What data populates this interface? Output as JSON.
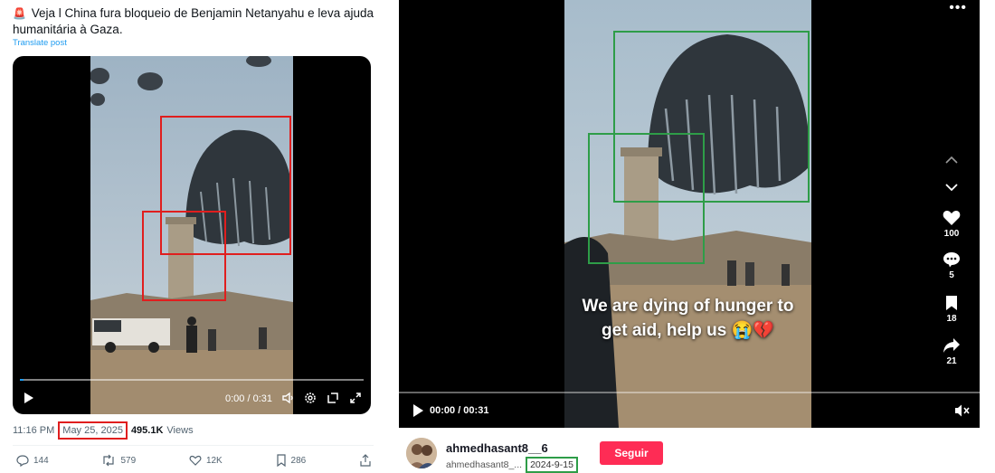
{
  "x_post": {
    "text": "Veja l China fura bloqueio de Benjamin Netanyahu e leva ajuda humanitária à Gaza.",
    "translate": "Translate post",
    "video": {
      "time": "0:00 / 0:31",
      "progress": 0.01
    },
    "meta": {
      "time": "11:16 PM",
      "date": "May 25, 2025",
      "views_count": "495.1K",
      "views_label": "Views"
    },
    "actions": {
      "replies": "144",
      "reposts": "579",
      "likes": "12K",
      "bookmarks": "286"
    },
    "highlight_color": "#e01e1e"
  },
  "tiktok": {
    "caption_line1": "We are dying of hunger to",
    "caption_line2": "get aid, help us 😭💔",
    "time": "00:00 / 00:31",
    "counts": {
      "likes": "100",
      "comments": "5",
      "saves": "18",
      "shares": "21"
    },
    "username": "ahmedhasant8__6",
    "handle": "ahmedhasant8_...",
    "date": "2024-9-15",
    "follow_label": "Seguir",
    "highlight_color": "#2e9d48",
    "accent_color": "#fe2c55"
  }
}
